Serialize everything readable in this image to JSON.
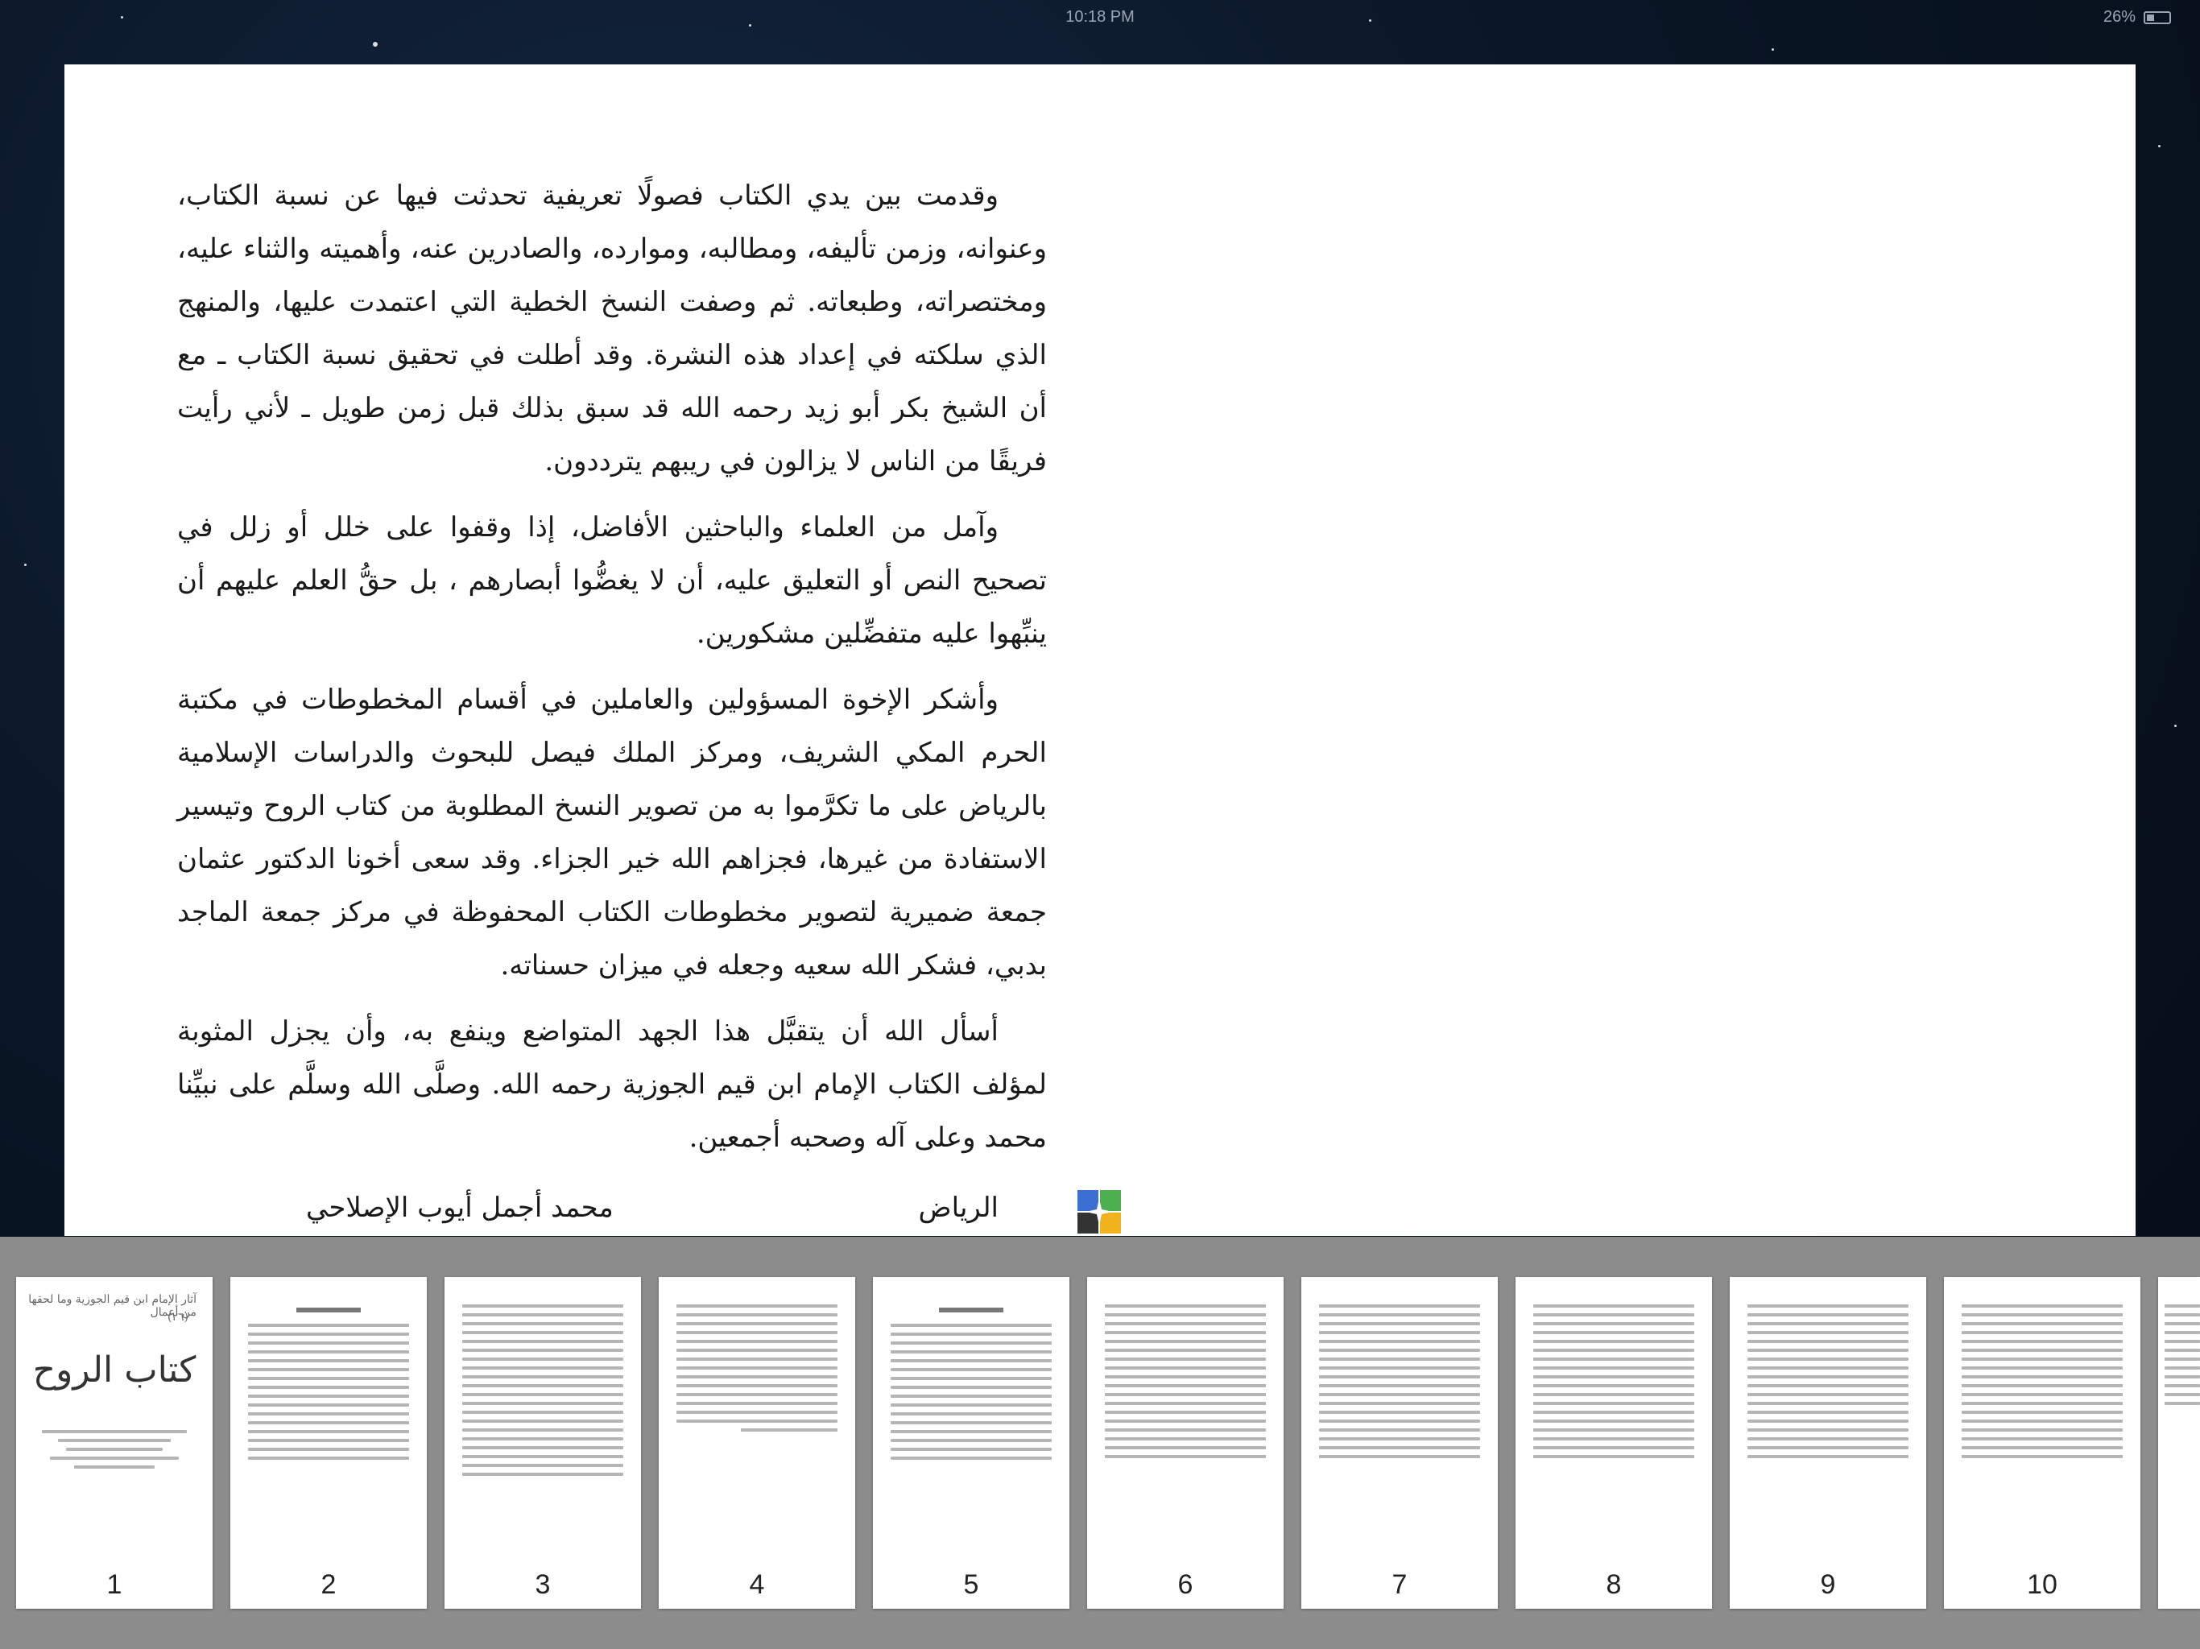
{
  "status_bar": {
    "time": "10:18 PM",
    "battery": "26%"
  },
  "page": {
    "paragraphs": [
      "وقدمت بين يدي الكتاب فصولًا تعريفية تحدثت فيها عن نسبة الكتاب، وعنوانه، وزمن تأليفه، ومطالبه، وموارده، والصادرين عنه، وأهميته والثناء عليه، ومختصراته، وطبعاته. ثم وصفت النسخ الخطية التي اعتمدت عليها، والمنهج الذي سلكته في إعداد هذه النشرة. وقد أطلت في تحقيق نسبة الكتاب ـ مع أن الشيخ بكر أبو زيد رحمه الله قد سبق بذلك قبل زمن طويل ـ لأني رأيت فريقًا من الناس لا يزالون في ريبهم يترددون.",
      "وآمل من العلماء والباحثين الأفاضل، إذا وقفوا على خلل أو زلل في تصحيح النص أو التعليق عليه، أن لا يغضُّوا أبصارهم ، بل حقُّ العلم عليهم أن ينبِّهوا عليه متفضِّلين مشكورين.",
      "وأشكر الإخوة المسؤولين والعاملين في أقسام المخطوطات في مكتبة الحرم المكي الشريف، ومركز الملك فيصل للبحوث والدراسات الإسلامية بالرياض على ما تكرَّموا به من تصوير النسخ المطلوبة من كتاب الروح وتيسير الاستفادة من غيرها، فجزاهم الله خير الجزاء. وقد سعى أخونا الدكتور عثمان جمعة ضميرية لتصوير مخطوطات الكتاب المحفوظة في مركز جمعة الماجد بدبي، فشكر الله سعيه وجعله في ميزان حسناته.",
      "أسأل الله أن يتقبَّل هذا الجهد المتواضع وينفع به، وأن يجزل المثوبة لمؤلف الكتاب الإمام ابن قيم الجوزية رحمه الله. وصلَّى الله وسلَّم على نبيِّنا محمد وعلى آله وصحبه أجمعين."
    ],
    "signature_name": "محمد أجمل أيوب الإصلاحي",
    "signature_place": "الرياض"
  },
  "app_logo_icon": "app-logo-icon",
  "thumbnails": [
    {
      "label": "1",
      "title": "كتاب الروح",
      "top_text": "آثار الإمام ابن قيم الجوزية وما لحقها من أعمال",
      "series": "(٢٦)"
    },
    {
      "label": "2",
      "heading": "مقدمة التحقيق"
    },
    {
      "label": "3"
    },
    {
      "label": "4"
    },
    {
      "label": "5",
      "heading": "تحقيق نسبة الكتاب"
    },
    {
      "label": "6"
    },
    {
      "label": "7"
    },
    {
      "label": "8"
    },
    {
      "label": "9"
    },
    {
      "label": "10"
    }
  ]
}
